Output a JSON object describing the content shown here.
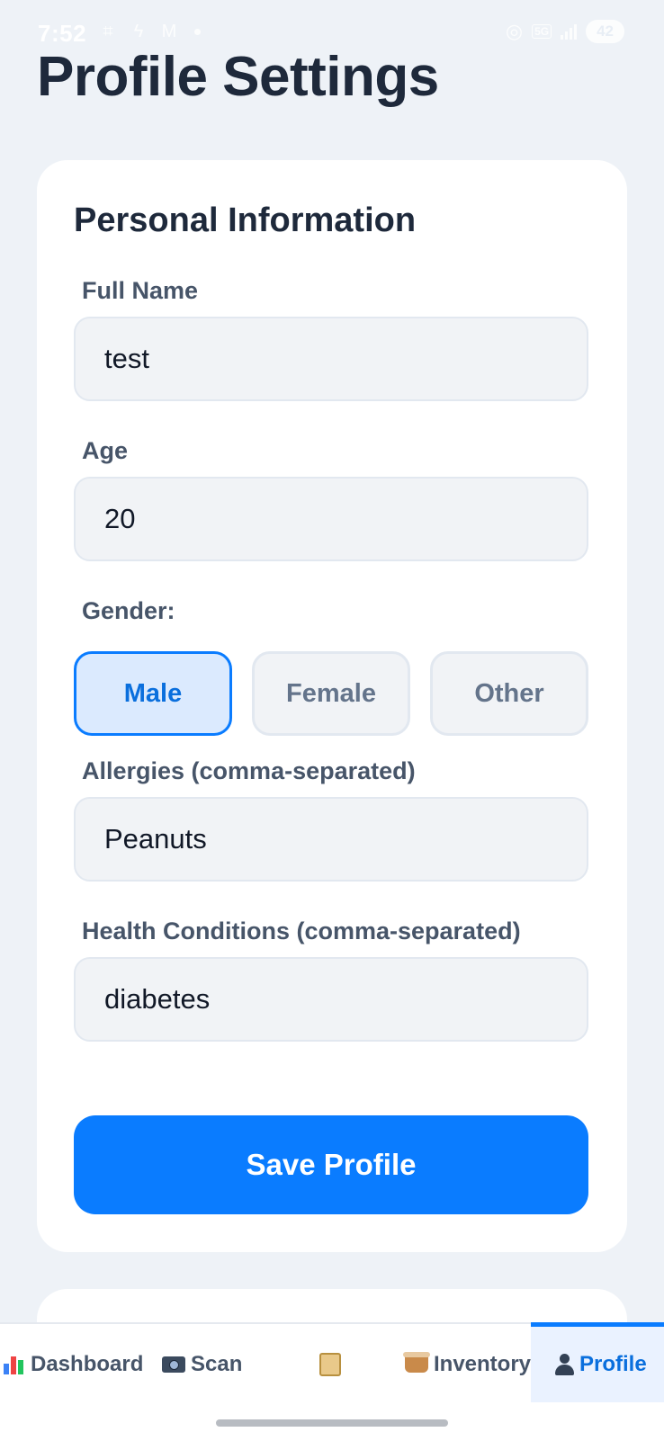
{
  "status_bar": {
    "time": "7:52",
    "network": "5G",
    "battery": "42"
  },
  "page": {
    "title": "Profile Settings"
  },
  "personal_info": {
    "title": "Personal Information",
    "full_name": {
      "label": "Full Name",
      "value": "test"
    },
    "age": {
      "label": "Age",
      "value": "20"
    },
    "gender": {
      "label": "Gender:",
      "options": [
        "Male",
        "Female",
        "Other"
      ],
      "selected": "Male"
    },
    "allergies": {
      "label": "Allergies (comma-separated)",
      "value": "Peanuts"
    },
    "health_conditions": {
      "label": "Health Conditions (comma-separated)",
      "value": "diabetes"
    },
    "save_label": "Save Profile"
  },
  "nav": {
    "items": [
      {
        "label": "Dashboard",
        "icon": "bar-chart-icon"
      },
      {
        "label": "Scan",
        "icon": "camera-icon"
      },
      {
        "label": "",
        "icon": "scroll-icon"
      },
      {
        "label": "Inventory",
        "icon": "basket-icon"
      },
      {
        "label": "Profile",
        "icon": "person-icon",
        "active": true
      }
    ]
  },
  "colors": {
    "accent": "#0a7cff",
    "background": "#eef2f7",
    "selected_bg": "#dbeafe",
    "input_bg": "#f1f3f6"
  }
}
